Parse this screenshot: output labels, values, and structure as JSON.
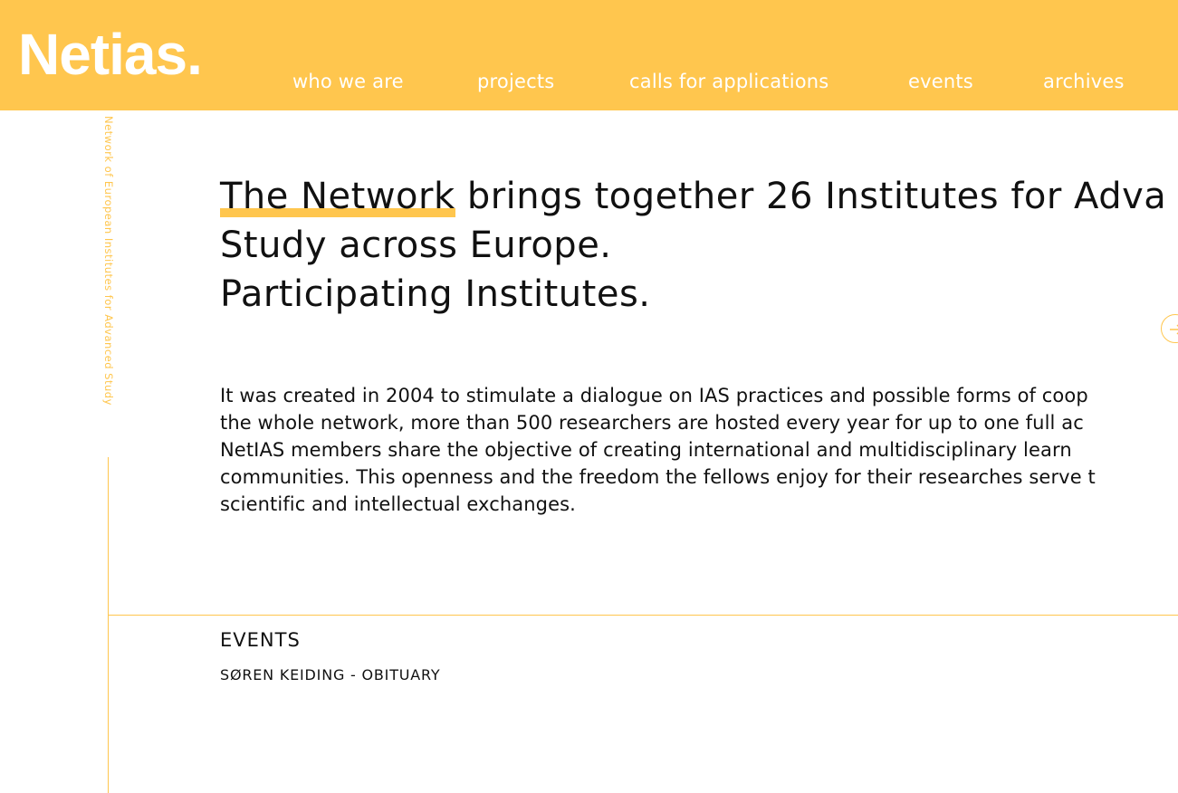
{
  "header": {
    "logo": "Netias.",
    "nav": [
      "who we are",
      "projects",
      "calls for applications",
      "events",
      "archives"
    ]
  },
  "side_text": "Network of European Institutes for Advanced Study",
  "headline": {
    "highlight": "The Network",
    "line1_rest": " brings together 26 Institutes for Adva",
    "line2": "Study across Europe.",
    "line3": "Participating Institutes."
  },
  "paragraph": [
    "It was created in 2004 to stimulate a dialogue on IAS practices and possible forms of coop",
    "the whole network, more than 500 researchers are hosted every year for up to one full ac",
    "NetIAS members share the objective of creating international and multidisciplinary learn",
    "communities. This openness and the freedom the fellows enjoy for their researches serve t",
    "scientific and intellectual exchanges."
  ],
  "events": {
    "title": "EVENTS",
    "items": [
      "SØREN KEIDING - OBITUARY"
    ]
  },
  "colors": {
    "accent": "#ffc64e",
    "text": "#111111"
  },
  "icons": {
    "circle_button": "arrow-right-icon"
  }
}
